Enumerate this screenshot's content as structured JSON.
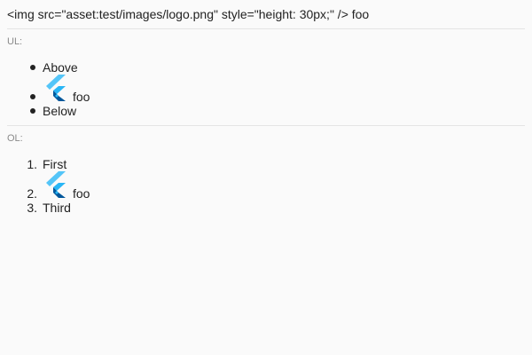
{
  "header": {
    "text": "<img src=\"asset:test/images/logo.png\" style=\"height: 30px;\" /> foo"
  },
  "ul_section": {
    "label": "UL:",
    "items": [
      {
        "text": "Above"
      },
      {
        "image_icon": "flutter-logo-icon",
        "text": "foo"
      },
      {
        "text": "Below"
      }
    ]
  },
  "ol_section": {
    "label": "OL:",
    "items": [
      {
        "marker": "1.",
        "text": "First"
      },
      {
        "marker": "2.",
        "image_icon": "flutter-logo-icon",
        "text": "foo"
      },
      {
        "marker": "3.",
        "text": "Third"
      }
    ]
  },
  "colors": {
    "background": "#fafafa",
    "text": "#222222",
    "label": "#8a8a8a",
    "divider": "#e4e4e4",
    "logo_light": "#54c5f8",
    "logo_mid": "#29b6f6",
    "logo_dark": "#01579b"
  }
}
